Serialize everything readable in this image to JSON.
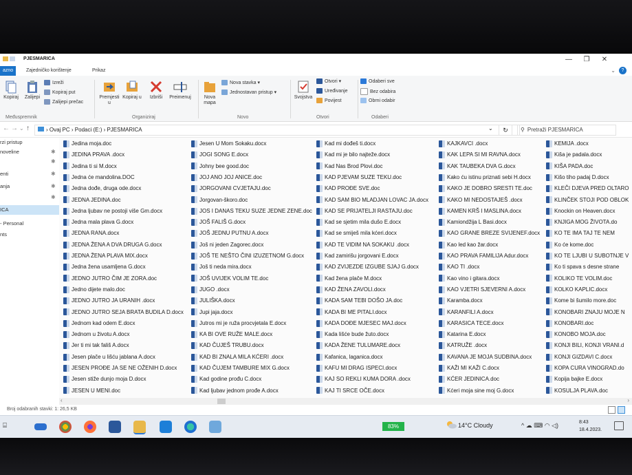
{
  "window": {
    "title": "PJESMARICA",
    "minimize": "—",
    "maximize": "❐",
    "close": "✕"
  },
  "tabs": [
    "azno",
    "Zajedničko korištenje",
    "Prikaz"
  ],
  "help": "?",
  "ribbon": {
    "clipboard": {
      "copy": "Kopiraj",
      "paste": "Zalijepi",
      "cut": "Izreži",
      "copy_path": "Kopiraj put",
      "paste_shortcut": "Zalijepi prečac",
      "group": "Međuspremnik"
    },
    "organize": {
      "move_to": "Premjesti u",
      "copy_to": "Kopiraj u",
      "delete": "Izbriši",
      "rename": "Preimenuj",
      "group": "Organiziraj"
    },
    "new": {
      "new_folder": "Nova mapa",
      "new_item": "Nova stavka",
      "easy_access": "Jednostavan pristup",
      "group": "Novo"
    },
    "open": {
      "properties": "Svojstva",
      "open": "Otvori",
      "edit": "Uređivanje",
      "history": "Povijest",
      "group": "Otvori"
    },
    "select": {
      "select_all": "Odaberi sve",
      "select_none": "Bez odabira",
      "invert": "Obrni odabir",
      "group": "Odaberi"
    }
  },
  "address": {
    "path": "›  Ovaj PC  ›  Podaci (E:)  ›  PJESMARICA",
    "search_placeholder": "Pretraži PJESMARICA"
  },
  "nav": [
    {
      "label": "rzi pristup",
      "selected": false
    },
    {
      "label": "noveline",
      "selected": false
    },
    {
      "label": "",
      "selected": false
    },
    {
      "label": "enti",
      "selected": false
    },
    {
      "label": "anja",
      "selected": false
    },
    {
      "label": "",
      "selected": false
    },
    {
      "label": "ICA",
      "selected": true
    },
    {
      "label": "- Personal",
      "selected": false
    },
    {
      "label": "nts",
      "selected": false
    }
  ],
  "columns": [
    [
      "Jedina moja.doc",
      "JEDINA PRAVA  .docx",
      "Jedina ti si        M.docx",
      "Jedna će mandolina.DOC",
      "Jedna dođe, druga ode.docx",
      "JEDNA JEDINA.doc",
      "Jedna ljubav ne postoji više Gm.docx",
      "Jedna mala plava  G.docx",
      "JEDNA RANA.docx",
      "JEDNA ŽENA A DVA DRUGA G.docx",
      "JEDNA ŽENA PLAVA MIX.docx",
      "Jedna žena usamljena G.docx",
      "JEDNO  JUTRO ČIM JE ZORA.doc",
      "Jedno dijete malo.doc",
      "JEDNO JUTRO JA URANIH      .docx",
      "JEDNO JUTRO SEJA BRATA BUDILA D.docx",
      "Jednom kad odem  E.docx",
      "Jednom u životu A.docx",
      "Jer ti mi tak fališ   A.docx",
      "Jesen plače u lišću jablana A.docx",
      "JESEN PRO­ĐE JA SE NE OŽENIH D.docx",
      "Jesen stiže dunjo moja D.docx",
      "JESEN U MENI.doc"
    ],
    [
      "Jesen U Mom Sokaku.docx",
      "JOGI SONG  E.docx",
      "Johny bee good.doc",
      "JOJ ANO JOJ ANICE.doc",
      "JORGOVANI CVJETAJU.doc",
      "Jorgovan-škoro.doc",
      "JOS I DANAS TEKU SUZE JEDNE ZENE.doc",
      "JOŠ FALIŠ G.docx",
      "JOŠ JEDNU PUTNU A.docx",
      "Još ni jeden Zagorec.docx",
      "JOŠ TE NEŠTO ČINI IZUZETNOM G.docx",
      "Još ti neda mira.docx",
      "JOŠ UVIJEK VOLIM TE.doc",
      "JUGO  .docx",
      "JULIŠKA.docx",
      "Jupi jaja.docx",
      "Jutros mi je ruža procvjetala E.docx",
      "KA BI OVE RUŽE MALE.docx",
      "KAD    ČUJEŠ  TRUBU.docx",
      "KAD BI ZNALA MILA KĆERI   .docx",
      "KAD ČUJEM TAMBURE MIX G.docx",
      "Kad godine prođu  C.docx",
      "Kad ljubav jednom prođe   A.docx"
    ],
    [
      "Kad mi dođeš ti.docx",
      "Kad mi je bilo najteže.docx",
      "Kad Nas Brod Plovi.doc",
      "KAD PJEVAM SUZE TEKU.doc",
      "KAD PRO­ĐE SVE.doc",
      "KAD SAM BIO MLADJAN LOVAC JA.docx",
      "KAD SE PRIJATELJI RASTAJU.doc",
      "Kad se sjetim mila dušo E.docx",
      "Kad se smiješ mila kćeri.docx",
      "KAD TE VIDIM NA SOKAKU  .docx",
      "Kad zamirišu jorgovani  E.docx",
      "KAD ZVIJEZDE IZGUBE SJAJ G.docx",
      "Kad žena plače        M.docx",
      "KAD ŽENA ZAVOLI.docx",
      "KADA  SAM  TEBI   DOŠO  JA.doc",
      "KADA BI ME PITALI.docx",
      "KADA DOĐE MJESEC MAJ.docx",
      "Kada lišće bude žuto.docx",
      "KADA ŽENE TULUMARE.docx",
      "Kafanica, laganica.docx",
      "KAFU MI DRAG ISPECI.docx",
      "KAJ SO REKLI KUMA DORA   .docx",
      "KAJ TI SRCE OČE.docx"
    ],
    [
      "KAJKAVCI      .docx",
      "KAK LEPA SI MI RAVNA.docx",
      "KAK TAUBEKA DVA G.docx",
      "Kako ću istinu priznati sebi H.docx",
      "KAKO JE DOBRO SRESTI TE.doc",
      "KAKO MI NEDOSTAJEŠ         .docx",
      "KAMEN KRŠ I MASLINA.docx",
      "Kamiondžija  L Basi.docx",
      "KAO GRANE BREZE SVIJENEF.docx",
      "Kao led kao žar.docx",
      "KAO PRAVA FAMILIJA  Adur.docx",
      "KAO TI   .docx",
      "Kao vino i gitara.docx",
      "KAO VJETRI SJEVERNI A.docx",
      "Karamba.docx",
      "KARANFILI A.docx",
      "KARASICA TECE.docx",
      "Katarina  E.docx",
      "KATRUŽE   .docx",
      "KAVANA JE MOJA SUDBINA.docx",
      "KAŽI MI KAŽI C.docx",
      "KĆER        JEDINICA.doc",
      "Kćeri moja sine moj G.docx"
    ],
    [
      "KEMIJA   .docx",
      "Kiša je padala.docx",
      "KIŠA PADA.doc",
      "Kišo tiho padaj  D.docx",
      "KLEČI DJEVA PRED OLTARO",
      "KLINČEK STOJI POD OBLOK",
      "Knockin on Heaven.docx",
      "KNJIGA  MOG   ŽIVOTA.do",
      "KO  TE  IMA   TAJ  TE  NEM",
      "Ko će kome.doc",
      "KO TE LJUBI U SUBOTNJE V",
      "Ko ti spava s desne strane",
      "KOLIKO  TE  VOLIM.doc",
      "KOLKO KAPLIC.docx",
      "Kome bi šumilo more.doc",
      "KONOBARI ZNAJU MOJE N",
      "KONOBARI.doc",
      "KONOBO  MOJA.doc",
      "KONJI BILI, KONJI VRANI.d",
      "KONJI GIZDAVI C.docx",
      "KOPA CURA VINOGRAD.do",
      "Kopija bajke   E.docx",
      "KOSULJA PLAVA.doc"
    ]
  ],
  "status": "Broj odabranih stavki: 1: 26,5 KB",
  "taskbar": {
    "battery": "83%",
    "weather": "14°C  Cloudy",
    "time": "8:43",
    "date": "18.4.2023."
  }
}
